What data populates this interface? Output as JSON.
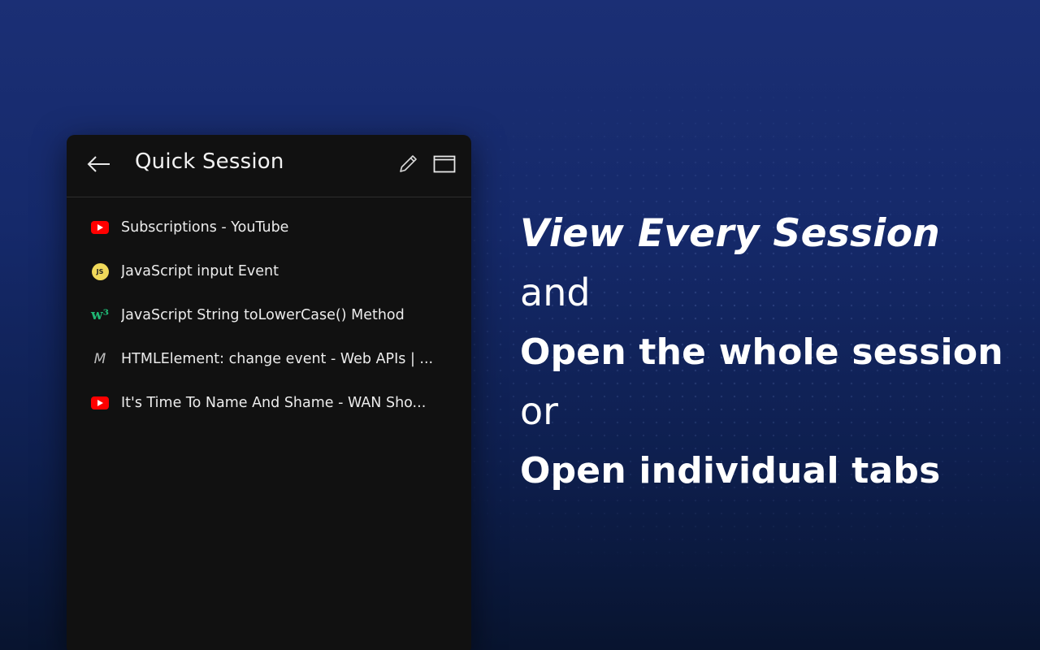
{
  "popup": {
    "title": "Quick Session",
    "icons": {
      "back": "arrow-left-icon",
      "edit": "pencil-icon",
      "window": "window-icon"
    },
    "tabs": [
      {
        "title": "Subscriptions - YouTube",
        "favicon": "youtube-icon"
      },
      {
        "title": "JavaScript input Event",
        "favicon": "javascript-icon",
        "favicon_text": "JS"
      },
      {
        "title": "JavaScript String toLowerCase() Method",
        "favicon": "w3schools-icon",
        "favicon_text": "w³"
      },
      {
        "title": "HTMLElement: change event - Web APIs | ...",
        "favicon": "mdn-icon",
        "favicon_text": "M"
      },
      {
        "title": "It's Time To Name And Shame - WAN Sho...",
        "favicon": "youtube-icon"
      }
    ]
  },
  "promo": {
    "line1": "View Every Session",
    "line2": "and",
    "line3": "Open the whole session",
    "line4": "or",
    "line5": "Open individual tabs"
  },
  "colors": {
    "background_top": "#1b2f75",
    "background_bottom": "#08142f",
    "popup_background": "#111111",
    "youtube_red": "#ff0000",
    "js_yellow": "#f0d95a",
    "w3_green": "#1fb573"
  }
}
